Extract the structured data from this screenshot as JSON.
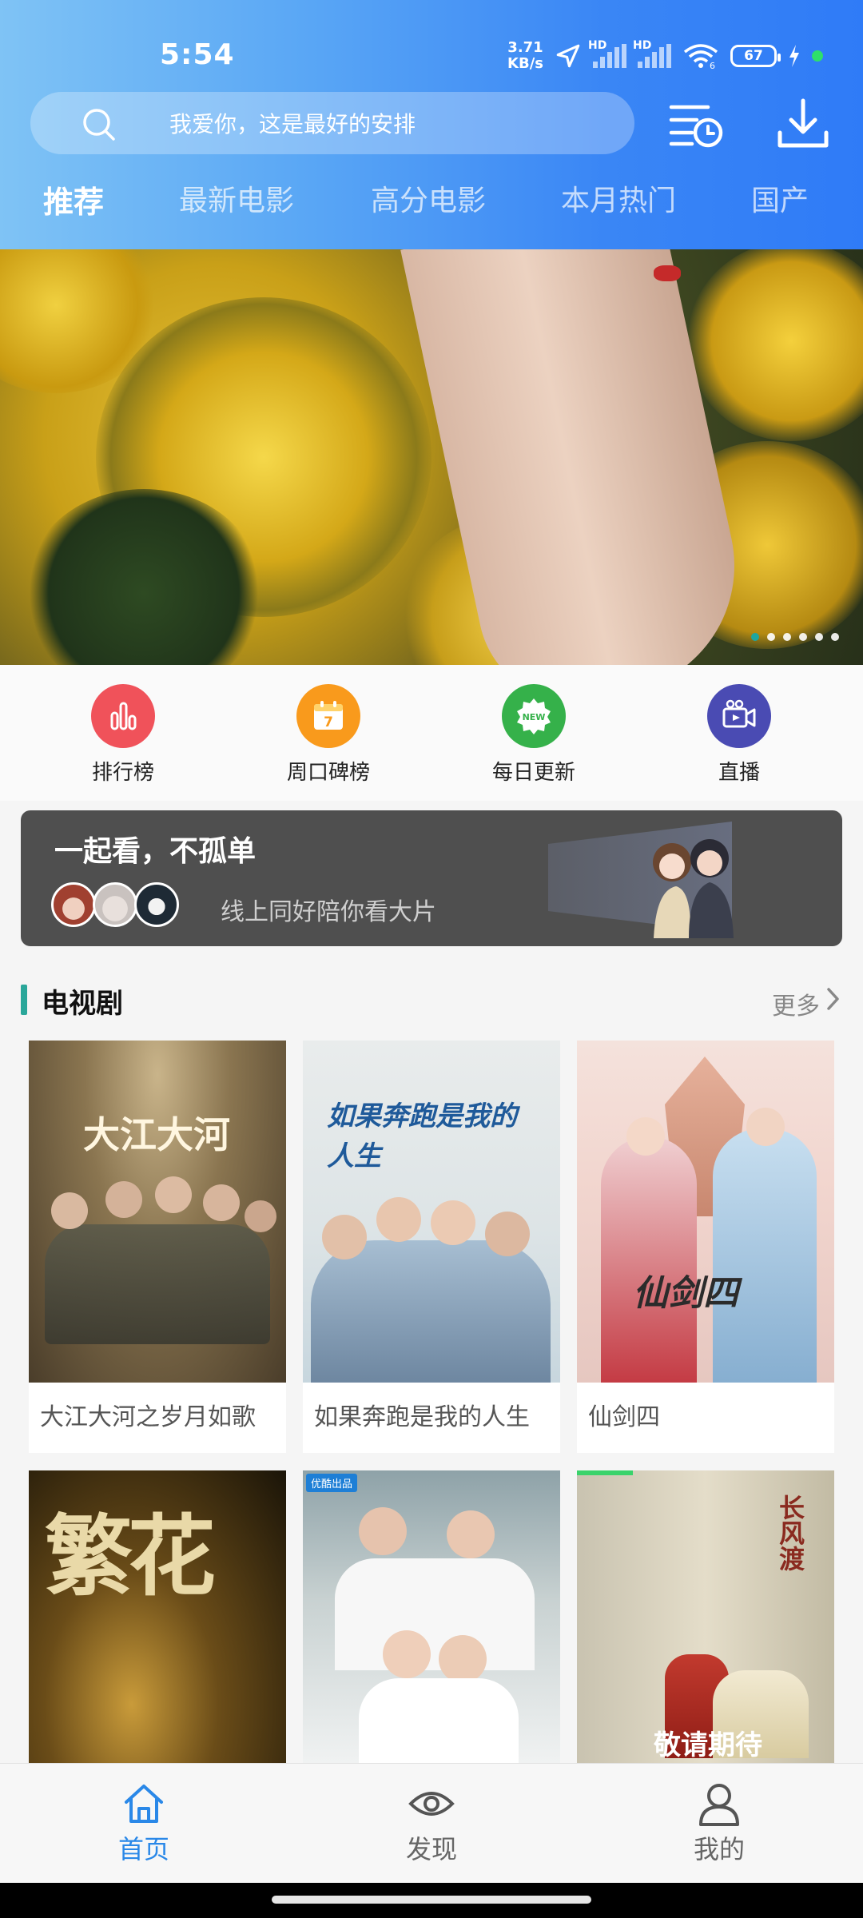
{
  "status_bar": {
    "time": "5:54",
    "net_speed_value": "3.71",
    "net_speed_unit": "KB/s",
    "signal_1_label": "HD",
    "signal_2_label": "HD",
    "wifi_label": "6",
    "battery": "67"
  },
  "header": {
    "search_placeholder": "我爱你，这是最好的安排",
    "tabs": [
      "推荐",
      "最新电影",
      "高分电影",
      "本月热门",
      "国产"
    ],
    "active_tab": 0
  },
  "banner": {
    "dot_count": 6,
    "active_dot": 0
  },
  "quick_actions": [
    {
      "label": "排行榜",
      "color": "#f0525a",
      "icon": "bar-chart-icon"
    },
    {
      "label": "周口碑榜",
      "color": "#f99a1c",
      "icon": "calendar-icon",
      "badge": "7"
    },
    {
      "label": "每日更新",
      "color": "#35b14a",
      "icon": "new-badge-icon",
      "badge": "NEW"
    },
    {
      "label": "直播",
      "color": "#4a4bb3",
      "icon": "live-camera-icon"
    }
  ],
  "watch_together": {
    "title": "一起看，不孤单",
    "subtitle": "线上同好陪你看大片"
  },
  "section": {
    "title": "电视剧",
    "more": "更多"
  },
  "cards": [
    {
      "title": "大江大河之岁月如歌",
      "poster_text": "大江大河"
    },
    {
      "title": "如果奔跑是我的人生",
      "poster_text": "如果奔跑是我的人生"
    },
    {
      "title": "仙剑四",
      "poster_text": "仙剑四"
    },
    {
      "title": "",
      "poster_text": "繁花"
    },
    {
      "title": "",
      "poster_text": "",
      "poster_badge": "优酷出品"
    },
    {
      "title": "",
      "poster_text": "长风渡",
      "poster_caption": "敬请期待"
    }
  ],
  "bottom_nav": [
    {
      "label": "首页",
      "active": true
    },
    {
      "label": "发现",
      "active": false
    },
    {
      "label": "我的",
      "active": false
    }
  ]
}
